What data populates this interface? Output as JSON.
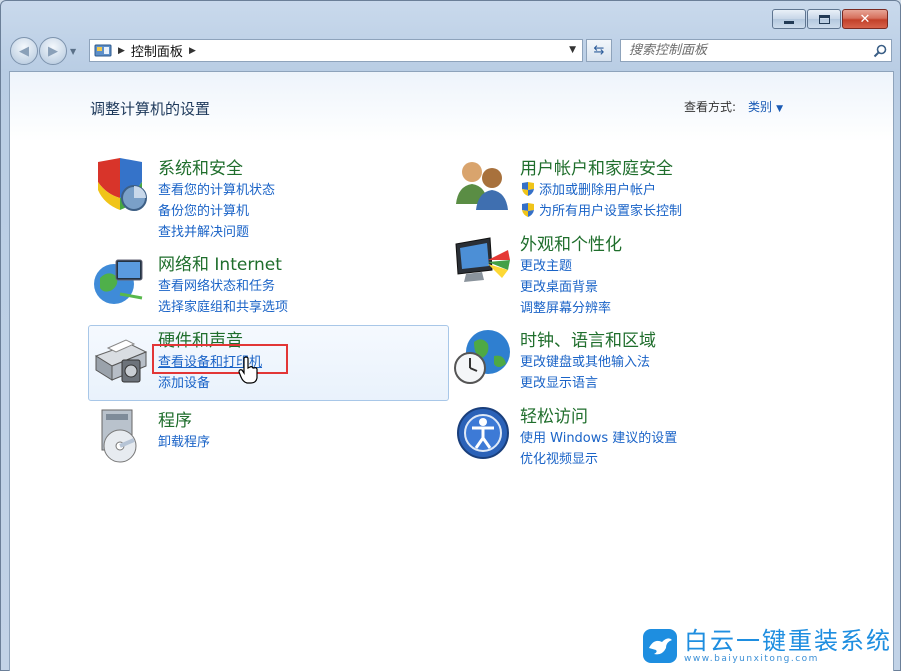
{
  "window": {
    "caption_minimize": "minimize",
    "caption_maximize": "maximize",
    "caption_close": "✕"
  },
  "address_bar": {
    "path": "控制面板"
  },
  "search": {
    "placeholder": "搜索控制面板"
  },
  "header": {
    "title": "调整计算机的设置",
    "view_by_label": "查看方式:",
    "view_by_value": "类别"
  },
  "categories": {
    "system_security": {
      "title": "系统和安全",
      "links": [
        "查看您的计算机状态",
        "备份您的计算机",
        "查找并解决问题"
      ]
    },
    "network": {
      "title": "网络和 Internet",
      "links": [
        "查看网络状态和任务",
        "选择家庭组和共享选项"
      ]
    },
    "hardware": {
      "title": "硬件和声音",
      "links": [
        "查看设备和打印机",
        "添加设备"
      ]
    },
    "programs": {
      "title": "程序",
      "links": [
        "卸载程序"
      ]
    },
    "user_accounts": {
      "title": "用户帐户和家庭安全",
      "links": [
        "添加或删除用户帐户",
        "为所有用户设置家长控制"
      ]
    },
    "appearance": {
      "title": "外观和个性化",
      "links": [
        "更改主题",
        "更改桌面背景",
        "调整屏幕分辨率"
      ]
    },
    "clock": {
      "title": "时钟、语言和区域",
      "links": [
        "更改键盘或其他输入法",
        "更改显示语言"
      ]
    },
    "ease": {
      "title": "轻松访问",
      "links": [
        "使用 Windows 建议的设置",
        "优化视频显示"
      ]
    }
  },
  "watermark": {
    "name": "白云一键重装系统",
    "url": "www.baiyunxitong.com"
  },
  "colors": {
    "category_title": "#1f6e2c",
    "link": "#1a63c7",
    "highlight_border": "#e23636"
  }
}
